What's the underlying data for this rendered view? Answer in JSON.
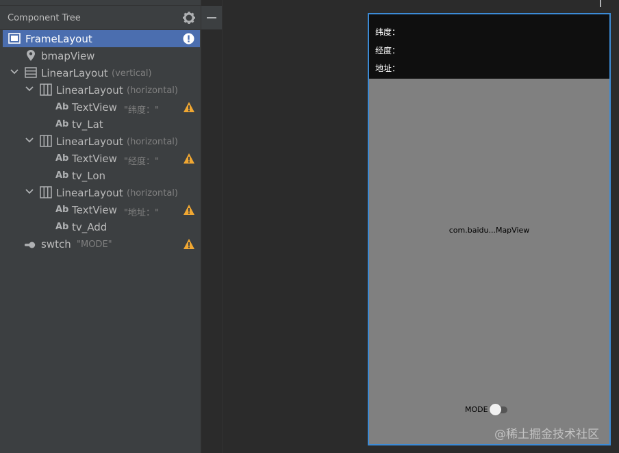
{
  "panel": {
    "title": "Component Tree"
  },
  "tree": {
    "frame": {
      "label": "FrameLayout"
    },
    "bmap": {
      "label": "bmapView"
    },
    "ll_vertical": {
      "label": "LinearLayout",
      "sub": "(vertical)"
    },
    "ll_h1": {
      "label": "LinearLayout",
      "sub": "(horizontal)"
    },
    "tv1": {
      "ab": "Ab",
      "label": "TextView",
      "sub": "\"纬度：\""
    },
    "tv_lat": {
      "ab": "Ab",
      "label": "tv_Lat"
    },
    "ll_h2": {
      "label": "LinearLayout",
      "sub": "(horizontal)"
    },
    "tv2": {
      "ab": "Ab",
      "label": "TextView",
      "sub": "\"经度：\""
    },
    "tv_lon": {
      "ab": "Ab",
      "label": "tv_Lon"
    },
    "ll_h3": {
      "label": "LinearLayout",
      "sub": "(horizontal)"
    },
    "tv3": {
      "ab": "Ab",
      "label": "TextView",
      "sub": "\"地址：\""
    },
    "tv_add": {
      "ab": "Ab",
      "label": "tv_Add"
    },
    "swtch": {
      "label": "swtch",
      "sub": "\"MODE\""
    }
  },
  "preview": {
    "lat_label": "纬度：",
    "lon_label": "经度：",
    "addr_label": "地址：",
    "mapview": "com.baidu...MapView",
    "switch_label": "MODE",
    "watermark": "@稀土掘金技术社区"
  },
  "colors": {
    "selection": "#4b6eaf",
    "warning": "#f0a732",
    "frame_border": "#3c8bd6"
  }
}
